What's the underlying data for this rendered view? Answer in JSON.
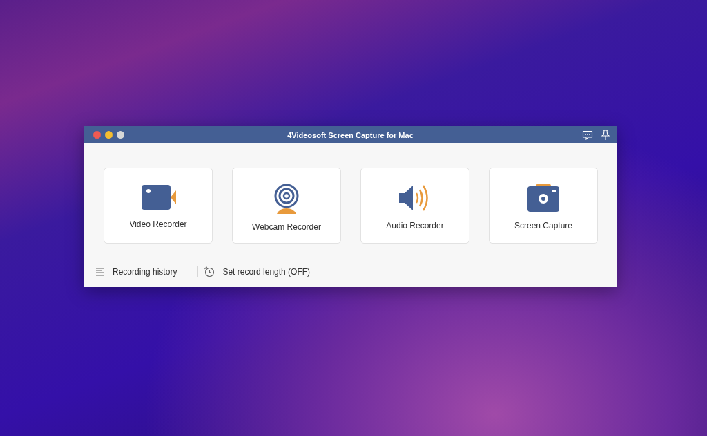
{
  "window": {
    "title": "4Videosoft Screen Capture for Mac"
  },
  "tools": [
    {
      "kind": "video",
      "label": "Video Recorder"
    },
    {
      "kind": "webcam",
      "label": "Webcam Recorder"
    },
    {
      "kind": "audio",
      "label": "Audio Recorder"
    },
    {
      "kind": "screenshot",
      "label": "Screen Capture"
    }
  ],
  "footer": [
    {
      "kind": "history",
      "label": "Recording history"
    },
    {
      "kind": "timer",
      "label": "Set record length (OFF)"
    }
  ]
}
